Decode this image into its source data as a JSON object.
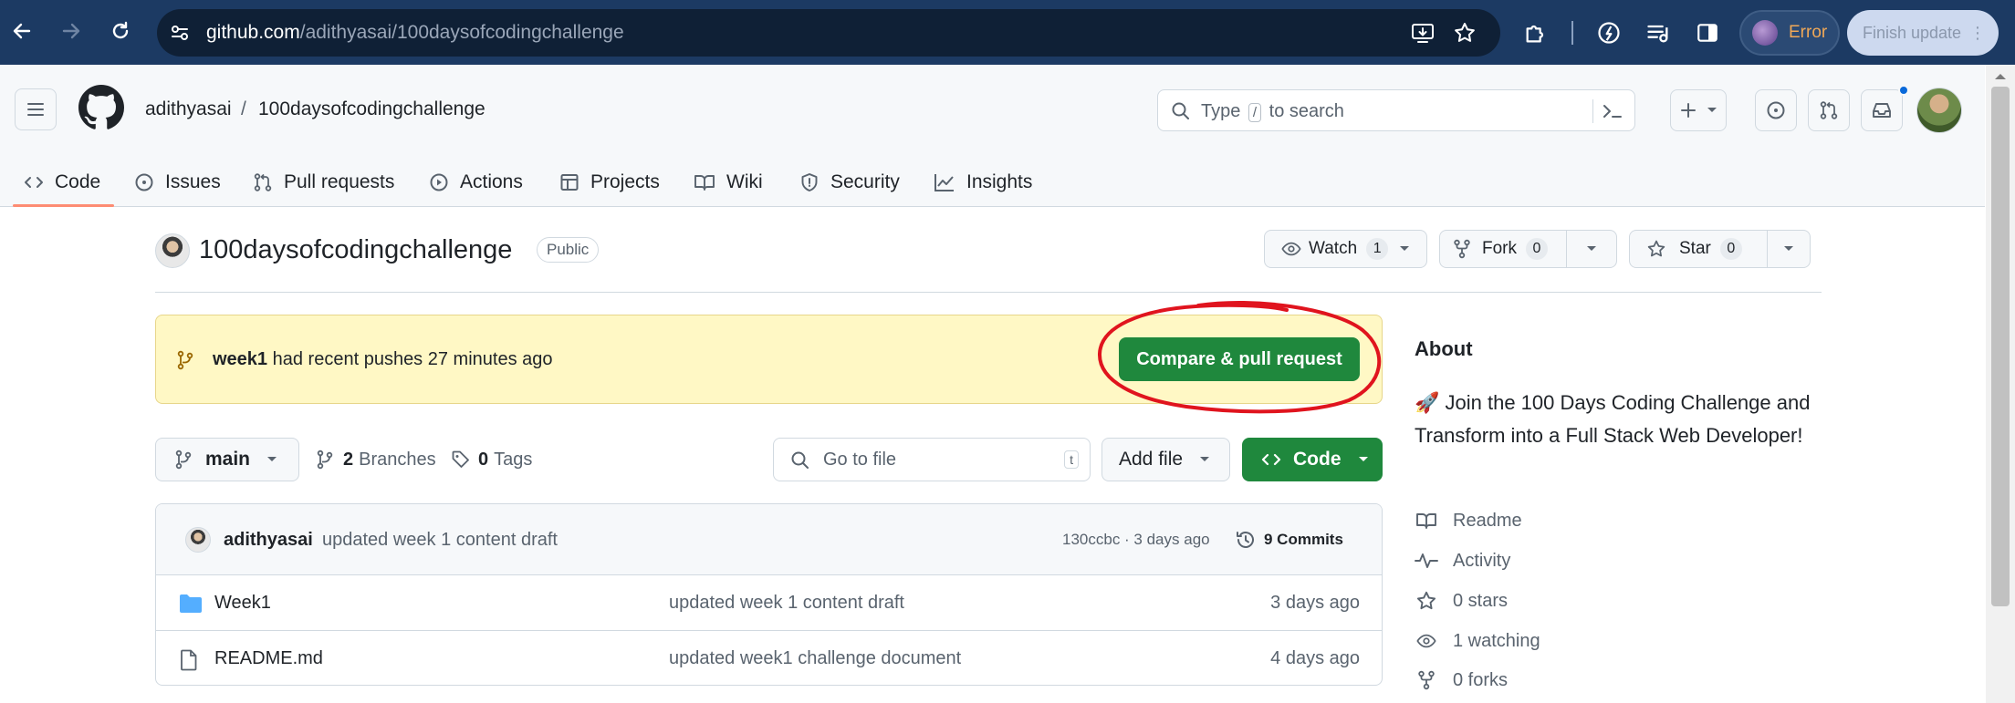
{
  "browser": {
    "url_host": "github.com",
    "url_path": "/adithyasai/100daysofcodingchallenge",
    "error_label": "Error",
    "finish_update_label": "Finish update"
  },
  "header": {
    "owner": "adithyasai",
    "separator": "/",
    "repo": "100daysofcodingchallenge",
    "search_prefix": "Type",
    "search_key": "/",
    "search_suffix": "to search",
    "tabs": [
      {
        "label": "Code",
        "icon": "code-icon"
      },
      {
        "label": "Issues",
        "icon": "issue-icon"
      },
      {
        "label": "Pull requests",
        "icon": "pull-request-icon"
      },
      {
        "label": "Actions",
        "icon": "play-icon"
      },
      {
        "label": "Projects",
        "icon": "table-icon"
      },
      {
        "label": "Wiki",
        "icon": "book-icon"
      },
      {
        "label": "Security",
        "icon": "shield-icon"
      },
      {
        "label": "Insights",
        "icon": "graph-icon"
      }
    ],
    "active_tab": "Code"
  },
  "repo": {
    "title": "100daysofcodingchallenge",
    "visibility": "Public",
    "watch_label": "Watch",
    "watch_count": "1",
    "fork_label": "Fork",
    "fork_count": "0",
    "star_label": "Star",
    "star_count": "0"
  },
  "banner": {
    "branch": "week1",
    "message": "had recent pushes 27 minutes ago",
    "button": "Compare & pull request",
    "highlight_color": "#e0141e"
  },
  "branch_bar": {
    "branch": "main",
    "branches_count": "2",
    "branches_label": "Branches",
    "tags_count": "0",
    "tags_label": "Tags",
    "goto_placeholder": "Go to file",
    "goto_key": "t",
    "add_file": "Add file",
    "code": "Code"
  },
  "latest_commit": {
    "author": "adithyasai",
    "message": "updated week 1 content draft",
    "meta": "130ccbc · 3 days ago",
    "commits_label": "9 Commits"
  },
  "files": [
    {
      "name": "Week1",
      "type": "folder",
      "commit": "updated week 1 content draft",
      "date": "3 days ago"
    },
    {
      "name": "README.md",
      "type": "file",
      "commit": "updated week1 challenge document",
      "date": "4 days ago"
    }
  ],
  "about": {
    "title": "About",
    "description": "🚀 Join the 100 Days Coding Challenge and Transform into a Full Stack Web Developer!",
    "items": [
      {
        "label": "Readme",
        "icon": "book-icon"
      },
      {
        "label": "Activity",
        "icon": "pulse-icon"
      },
      {
        "label": "0 stars",
        "icon": "star-icon"
      },
      {
        "label": "1 watching",
        "icon": "eye-icon"
      },
      {
        "label": "0 forks",
        "icon": "fork-icon"
      }
    ]
  },
  "colors": {
    "chrome_bg": "#1c3a63",
    "primary_green": "#1f883d",
    "banner_bg": "#fff8c5",
    "active_tab_underline": "#fd8c73",
    "link_blue": "#0969da"
  }
}
